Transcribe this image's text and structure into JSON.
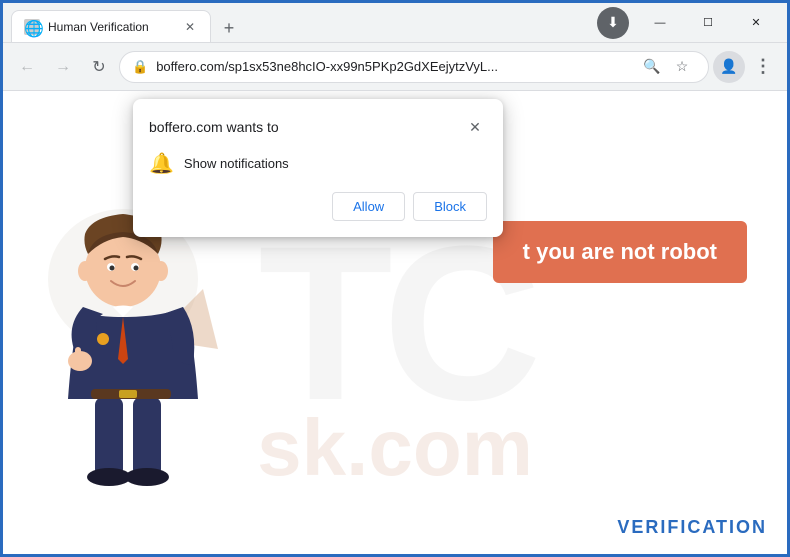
{
  "browser": {
    "tab": {
      "title": "Human Verification",
      "favicon": "🌐"
    },
    "new_tab_label": "+",
    "window_controls": {
      "minimize": "—",
      "maximize": "☐",
      "close": "✕"
    },
    "toolbar": {
      "back_label": "←",
      "forward_label": "→",
      "reload_label": "↻",
      "lock_icon": "🔒",
      "url": "boffero.com/sp1sx53ne8hcIO-xx99n5PKp2GdXEejytzVyL...",
      "search_icon": "🔍",
      "star_icon": "☆",
      "profile_icon": "👤",
      "menu_icon": "⋮",
      "download_icon": "⬇"
    }
  },
  "popup": {
    "site": "boffero.com wants to",
    "permission": "Show notifications",
    "bell_icon": "🔔",
    "close_icon": "✕",
    "allow_label": "Allow",
    "block_label": "Block"
  },
  "page": {
    "robot_button": "t you are not robot",
    "watermark_text": "TC",
    "watermark_sub": "sk.com",
    "watermark_br": "VERIFICATION"
  }
}
